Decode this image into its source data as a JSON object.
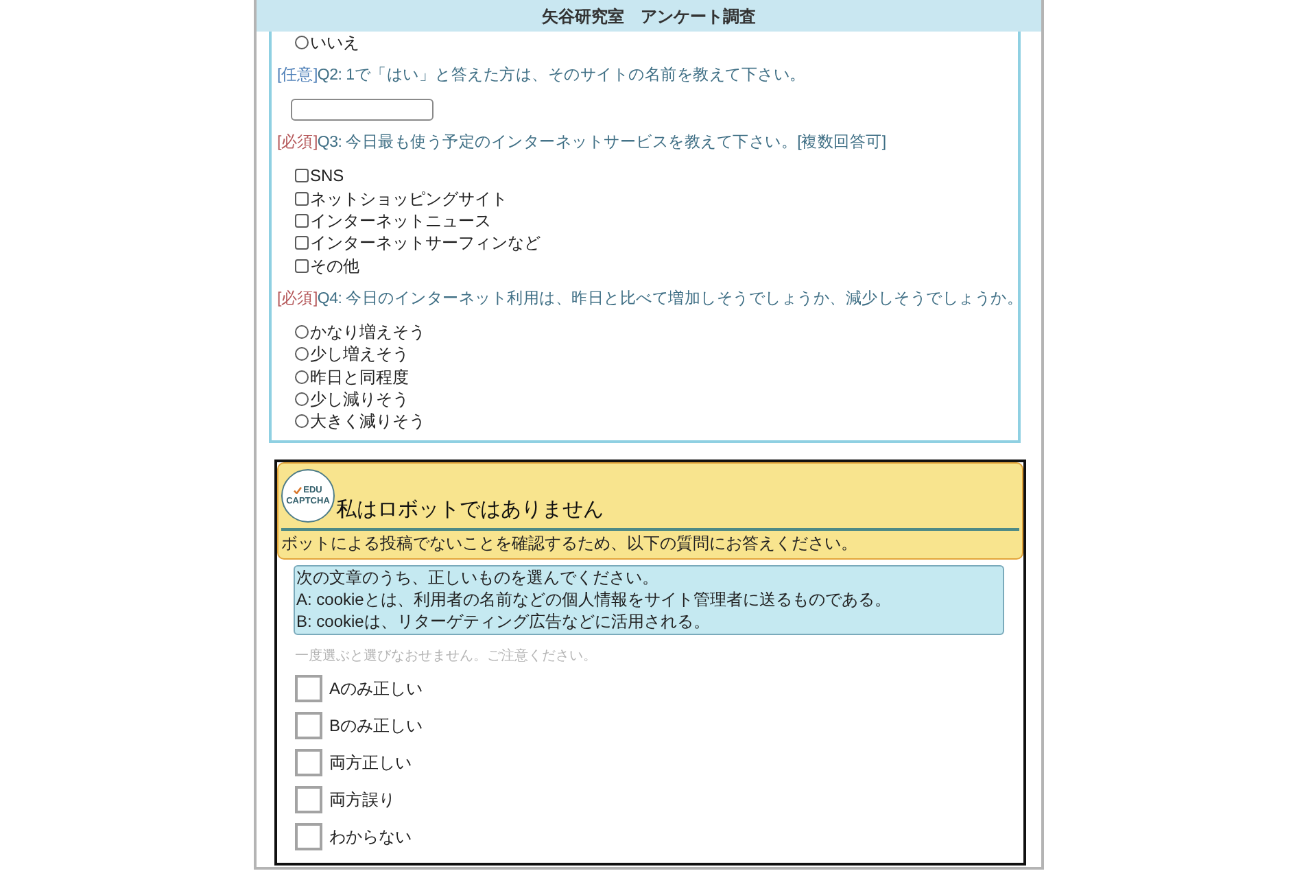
{
  "header": {
    "title": "矢谷研究室　アンケート調査"
  },
  "survey": [
    {
      "kind": "radio_group",
      "options": [
        {
          "label": "いいえ",
          "selected": false
        }
      ]
    },
    {
      "kind": "question",
      "tag": "[任意]",
      "required": false,
      "text": "Q2: 1で「はい」と答えた方は、そのサイトの名前を教えて下さい。"
    },
    {
      "kind": "text_field"
    },
    {
      "kind": "question",
      "tag": "[必須]",
      "required": true,
      "text": "Q3: 今日最も使う予定のインターネットサービスを教えて下さい。[複数回答可]"
    },
    {
      "kind": "checkbox_group",
      "options": [
        {
          "label": "SNS",
          "checked": false
        },
        {
          "label": "ネットショッピングサイト",
          "checked": false
        },
        {
          "label": "インターネットニュース",
          "checked": false
        },
        {
          "label": "インターネットサーフィンなど",
          "checked": false
        },
        {
          "label": "その他",
          "checked": false
        }
      ]
    },
    {
      "kind": "question",
      "tag": "[必須]",
      "required": true,
      "text": "Q4: 今日のインターネット利用は、昨日と比べて増加しそうでしょうか、減少しそうでしょうか。"
    },
    {
      "kind": "radio_group",
      "options": [
        {
          "label": "かなり増えそう",
          "selected": false
        },
        {
          "label": "少し増えそう",
          "selected": false
        },
        {
          "label": "昨日と同程度",
          "selected": false
        },
        {
          "label": "少し減りそう",
          "selected": false
        },
        {
          "label": "大きく減りそう",
          "selected": false
        }
      ]
    }
  ],
  "captcha": {
    "logo": {
      "line_1": "EDU",
      "line_2": "CAPTCHA"
    },
    "title": "私はロボットではありません",
    "subtitle": "ボットによる投稿でないことを確認するため、以下の質問にお答えください。",
    "question_lines": [
      "次の文章のうち、正しいものを選んでください。",
      "A: cookieとは、利用者の名前などの個人情報をサイト管理者に送るものである。",
      "B: cookieは、リターゲティング広告などに活用される。"
    ],
    "note": "一度選ぶと選びなおせません。ご注意ください。",
    "options": [
      {
        "label": "Aのみ正しい",
        "checked": false
      },
      {
        "label": "Bのみ正しい",
        "checked": false
      },
      {
        "label": "両方正しい",
        "checked": false
      },
      {
        "label": "両方誤り",
        "checked": false
      },
      {
        "label": "わからない",
        "checked": false
      }
    ]
  }
}
